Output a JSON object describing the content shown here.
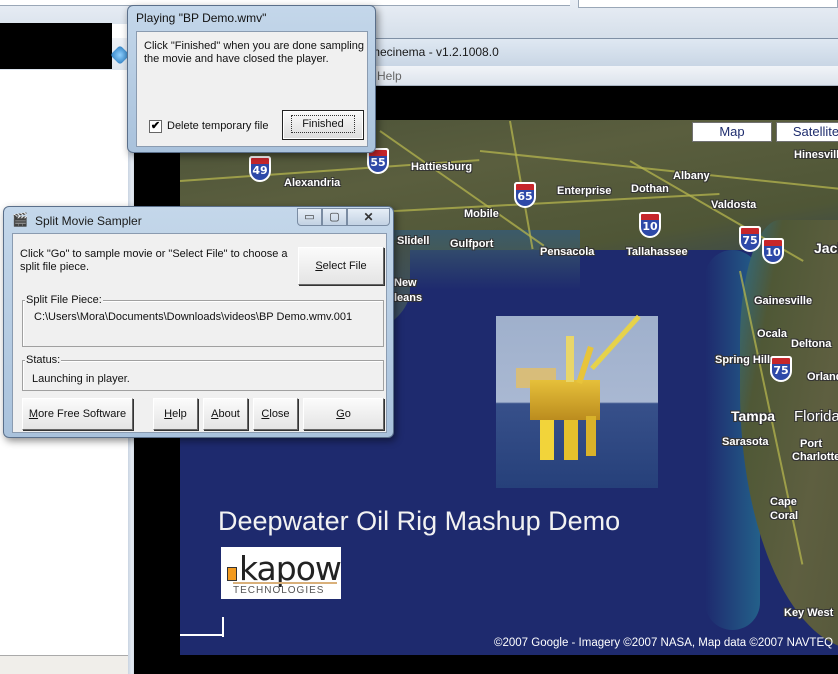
{
  "background": {
    "nav_icon": "nav-arrow-icon"
  },
  "player": {
    "title_partial": "mecinema - v1.2.1008.0",
    "menu_help_partial": "Help"
  },
  "video": {
    "map_buttons": [
      "Map",
      "Satellite"
    ],
    "shields": [
      "49",
      "55",
      "65",
      "10",
      "75",
      "10",
      "75"
    ],
    "cities": [
      "Alexandria",
      "Hattiesburg",
      "Enterprise",
      "Dothan",
      "Albany",
      "Valdosta",
      "Hinesville",
      "Mobile",
      "Slidell",
      "Gulfport",
      "Pensacola",
      "Tallahassee",
      "Jack",
      "New",
      "leans",
      "Gainesville",
      "Ocala",
      "Deltona",
      "Spring Hill",
      "Orland",
      "Tampa",
      "Sarasota",
      "Port",
      "Charlotte",
      "Cape",
      "Coral",
      "Key West"
    ],
    "states": [
      "Florida"
    ],
    "title": "Deepwater Oil Rig Mashup Demo",
    "logo": {
      "word": "kapow",
      "subtitle": "TECHNOLOGIES"
    },
    "copyright": "©2007 Google - Imagery ©2007 NASA, Map data ©2007 NAVTEQ"
  },
  "dialog_playing": {
    "title": "Playing \"BP Demo.wmv\"",
    "message": "Click \"Finished\" when you are done sampling the movie and have closed the player.",
    "checkbox_label": "Delete temporary file",
    "checkbox_checked": true,
    "checkbox_mark": "✔",
    "finished_button": "Finished"
  },
  "dialog_split": {
    "title": "Split Movie Sampler",
    "icon": "🎬",
    "caption": {
      "minimize": "▭",
      "maximize": "▢",
      "close": "✕"
    },
    "message": "Click \"Go\" to sample movie or \"Select File\" to choose a split file piece.",
    "select_file_button": {
      "accel": "S",
      "rest": "elect File"
    },
    "piece_label": "Split File Piece:",
    "piece_path": "C:\\Users\\Mora\\Documents\\Downloads\\videos\\BP Demo.wmv.001",
    "status_label": "Status:",
    "status_text": "Launching in player.",
    "buttons": {
      "more": {
        "accel": "M",
        "rest": "ore Free Software"
      },
      "help": {
        "accel": "H",
        "rest": "elp"
      },
      "about": {
        "accel": "A",
        "rest": "bout"
      },
      "close": {
        "accel": "C",
        "rest": "lose"
      },
      "go": {
        "accel": "G",
        "rest": "o"
      }
    }
  }
}
